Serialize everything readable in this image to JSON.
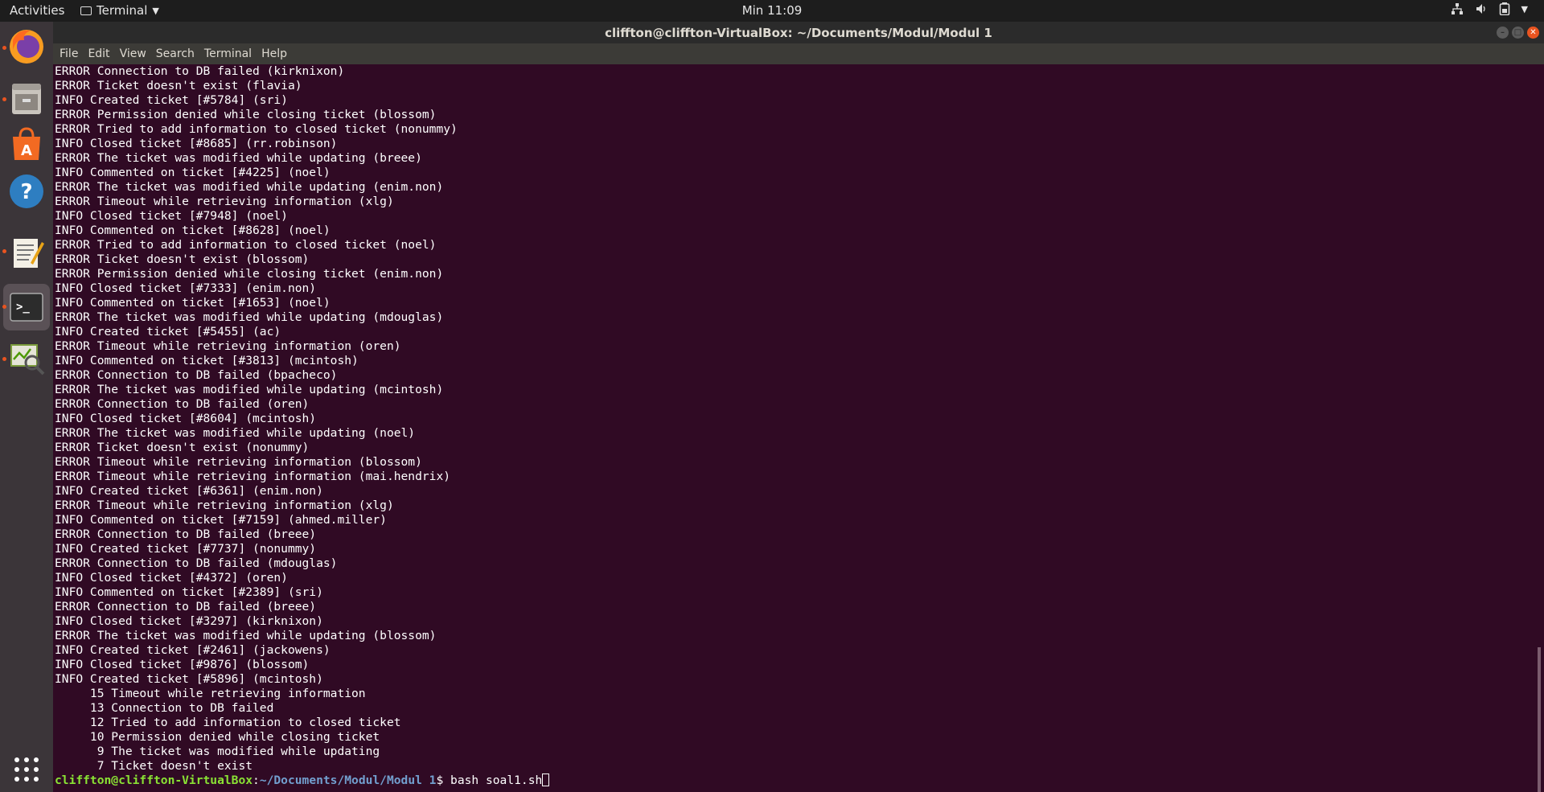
{
  "topbar": {
    "activities": "Activities",
    "app_name": "Terminal",
    "clock": "Min 11:09"
  },
  "dock": {
    "items": [
      "firefox-icon",
      "files-icon",
      "software-icon",
      "help-icon",
      "text-editor-icon",
      "terminal-icon",
      "system-monitor-icon",
      "show-apps-icon"
    ]
  },
  "window": {
    "title": "cliffton@cliffton-VirtualBox: ~/Documents/Modul/Modul 1"
  },
  "menu": [
    "File",
    "Edit",
    "View",
    "Search",
    "Terminal",
    "Help"
  ],
  "terminal": {
    "lines": [
      "ERROR Connection to DB failed (kirknixon)",
      "ERROR Ticket doesn't exist (flavia)",
      "INFO Created ticket [#5784] (sri)",
      "ERROR Permission denied while closing ticket (blossom)",
      "ERROR Tried to add information to closed ticket (nonummy)",
      "INFO Closed ticket [#8685] (rr.robinson)",
      "ERROR The ticket was modified while updating (breee)",
      "INFO Commented on ticket [#4225] (noel)",
      "ERROR The ticket was modified while updating (enim.non)",
      "ERROR Timeout while retrieving information (xlg)",
      "INFO Closed ticket [#7948] (noel)",
      "INFO Commented on ticket [#8628] (noel)",
      "ERROR Tried to add information to closed ticket (noel)",
      "ERROR Ticket doesn't exist (blossom)",
      "ERROR Permission denied while closing ticket (enim.non)",
      "INFO Closed ticket [#7333] (enim.non)",
      "INFO Commented on ticket [#1653] (noel)",
      "ERROR The ticket was modified while updating (mdouglas)",
      "INFO Created ticket [#5455] (ac)",
      "ERROR Timeout while retrieving information (oren)",
      "INFO Commented on ticket [#3813] (mcintosh)",
      "ERROR Connection to DB failed (bpacheco)",
      "ERROR The ticket was modified while updating (mcintosh)",
      "ERROR Connection to DB failed (oren)",
      "INFO Closed ticket [#8604] (mcintosh)",
      "ERROR The ticket was modified while updating (noel)",
      "ERROR Ticket doesn't exist (nonummy)",
      "ERROR Timeout while retrieving information (blossom)",
      "ERROR Timeout while retrieving information (mai.hendrix)",
      "INFO Created ticket [#6361] (enim.non)",
      "ERROR Timeout while retrieving information (xlg)",
      "INFO Commented on ticket [#7159] (ahmed.miller)",
      "ERROR Connection to DB failed (breee)",
      "INFO Created ticket [#7737] (nonummy)",
      "ERROR Connection to DB failed (mdouglas)",
      "INFO Closed ticket [#4372] (oren)",
      "INFO Commented on ticket [#2389] (sri)",
      "ERROR Connection to DB failed (breee)",
      "INFO Closed ticket [#3297] (kirknixon)",
      "ERROR The ticket was modified while updating (blossom)",
      "INFO Created ticket [#2461] (jackowens)",
      "INFO Closed ticket [#9876] (blossom)",
      "INFO Created ticket [#5896] (mcintosh)",
      "     15 Timeout while retrieving information",
      "     13 Connection to DB failed",
      "     12 Tried to add information to closed ticket",
      "     10 Permission denied while closing ticket",
      "      9 The ticket was modified while updating",
      "      7 Ticket doesn't exist"
    ],
    "prompt_user": "cliffton@cliffton-VirtualBox",
    "prompt_sep": ":",
    "prompt_path": "~/Documents/Modul/Modul 1",
    "prompt_symbol": "$ ",
    "command": "bash soal1.sh"
  },
  "colors": {
    "terminal_bg": "#300a24",
    "prompt_user": "#8ae234",
    "prompt_path": "#729fcf",
    "accent": "#e95420"
  }
}
